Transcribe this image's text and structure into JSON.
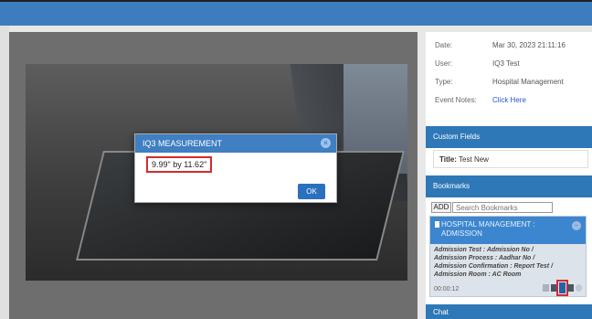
{
  "modal": {
    "title": "IQ3 MEASUREMENT",
    "measurement": "9.99\" by 11.62\"",
    "ok_label": "OK"
  },
  "info": {
    "date_label": "Date:",
    "date_value": "Mar 30, 2023 21:11:16",
    "user_label": "User:",
    "user_value": "IQ3 Test",
    "type_label": "Type:",
    "type_value": "Hospital Management",
    "notes_label": "Event Notes:",
    "notes_value": "Click Here"
  },
  "custom_fields": {
    "header": "Custom Fields",
    "title_label": "Title:",
    "title_value": "Test New"
  },
  "bookmarks": {
    "header": "Bookmarks",
    "add_label": "ADD",
    "search_placeholder": "Search Bookmarks",
    "item": {
      "title_line1": "HOSPITAL MANAGEMENT :",
      "title_line2": "ADMISSION",
      "details": [
        "Admission Test : Admission No /",
        "Admission Process : Aadhar No /",
        "Admission Confirmation : Report Test /",
        "Admission Room : AC Room"
      ],
      "time": "00:00:12"
    }
  },
  "chat": {
    "header": "Chat"
  },
  "icons": [
    "close-icon",
    "bookmark-flag-icon",
    "collapse-icon",
    "note-icon",
    "document-icon",
    "measure-icon",
    "car-icon",
    "gear-icon"
  ]
}
